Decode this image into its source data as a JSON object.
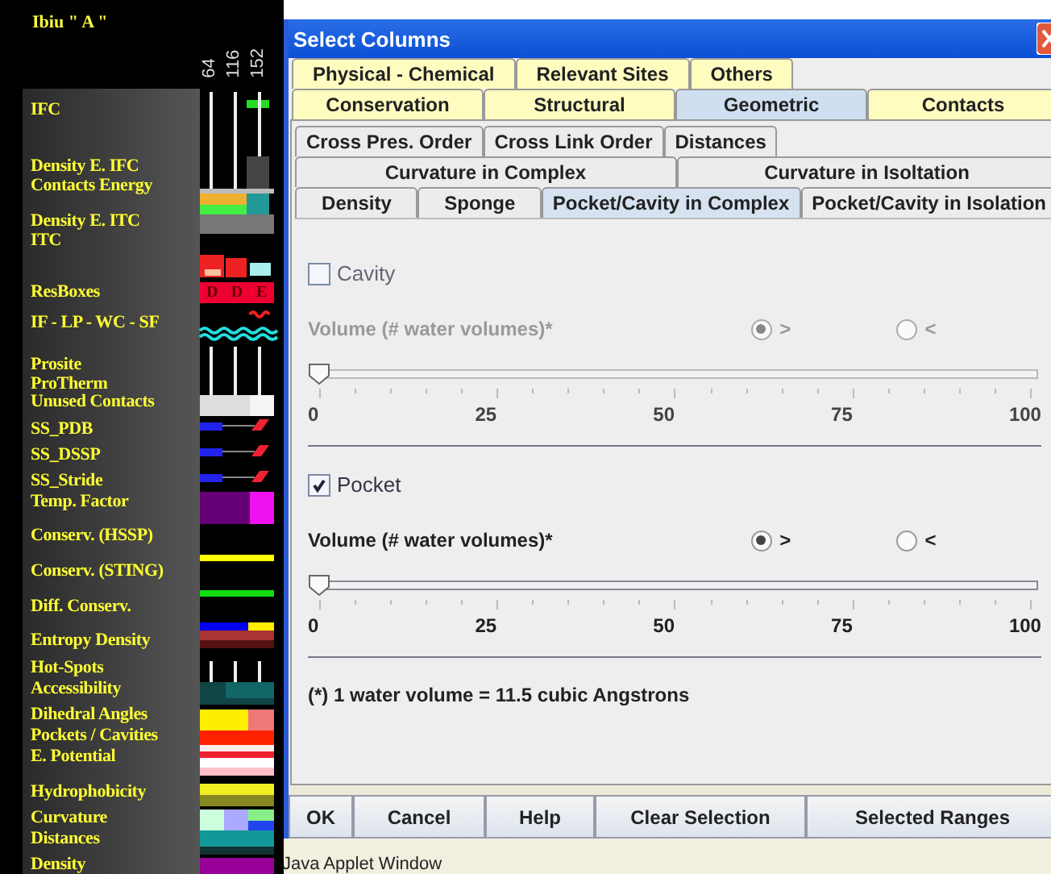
{
  "viewer": {
    "title": "Ibiu \" A \"",
    "columns": [
      "64",
      "116",
      "152"
    ],
    "labels": [
      "IFC",
      "Density E. IFC",
      "Contacts Energy",
      "Density E. ITC",
      "ITC",
      "ResBoxes",
      "IF - LP - WC - SF",
      "Prosite",
      "ProTherm",
      "Unused Contacts",
      "SS_PDB",
      "SS_DSSP",
      "SS_Stride",
      "Temp. Factor",
      "Conserv. (HSSP)",
      "Conserv. (STING)",
      "Diff. Conserv.",
      "Entropy Density",
      "Hot-Spots",
      "Accessibility",
      "Dihedral Angles",
      "Pockets / Cavities",
      "E. Potential",
      "Hydrophobicity",
      "Curvature",
      "Distances",
      "Density"
    ],
    "resboxes": [
      "D",
      "D",
      "E"
    ]
  },
  "dialog": {
    "title": "Select Columns",
    "tab_rows": [
      [
        {
          "label": "Physical - Chemical",
          "selected": false
        },
        {
          "label": "Relevant Sites",
          "selected": false
        },
        {
          "label": "Others",
          "selected": false
        }
      ],
      [
        {
          "label": "Conservation",
          "selected": false
        },
        {
          "label": "Structural",
          "selected": false
        },
        {
          "label": "Geometric",
          "selected": true
        },
        {
          "label": "Contacts",
          "selected": false
        }
      ]
    ],
    "subtab_rows": [
      [
        {
          "label": "Cross Pres. Order",
          "selected": false
        },
        {
          "label": "Cross Link Order",
          "selected": false
        },
        {
          "label": "Distances",
          "selected": false
        }
      ],
      [
        {
          "label": "Curvature in Complex",
          "selected": false
        },
        {
          "label": "Curvature in Isoltation",
          "selected": false
        }
      ],
      [
        {
          "label": "Density",
          "selected": false
        },
        {
          "label": "Sponge",
          "selected": false
        },
        {
          "label": "Pocket/Cavity in Complex",
          "selected": true
        },
        {
          "label": "Pocket/Cavity in Isolation",
          "selected": false
        }
      ]
    ],
    "sections": [
      {
        "label": "Cavity",
        "checked": false,
        "enabled": false,
        "volume_label": "Volume (# water volumes)*",
        "radios": [
          {
            "label": ">",
            "selected": true
          },
          {
            "label": "<",
            "selected": false
          }
        ],
        "slider": {
          "level": 0,
          "ticks": [
            "0",
            "25",
            "50",
            "75",
            "100"
          ]
        }
      },
      {
        "label": "Pocket",
        "checked": true,
        "enabled": true,
        "volume_label": "Volume (# water volumes)*",
        "radios": [
          {
            "label": ">",
            "selected": true
          },
          {
            "label": "<",
            "selected": false
          }
        ],
        "slider": {
          "level": 0,
          "ticks": [
            "0",
            "25",
            "50",
            "75",
            "100"
          ]
        }
      }
    ],
    "footnote": "(*) 1 water volume = 11.5 cubic Angstrons",
    "buttons": [
      "OK",
      "Cancel",
      "Help",
      "Clear Selection",
      "Selected Ranges"
    ]
  },
  "status_bar": "Java Applet Window"
}
